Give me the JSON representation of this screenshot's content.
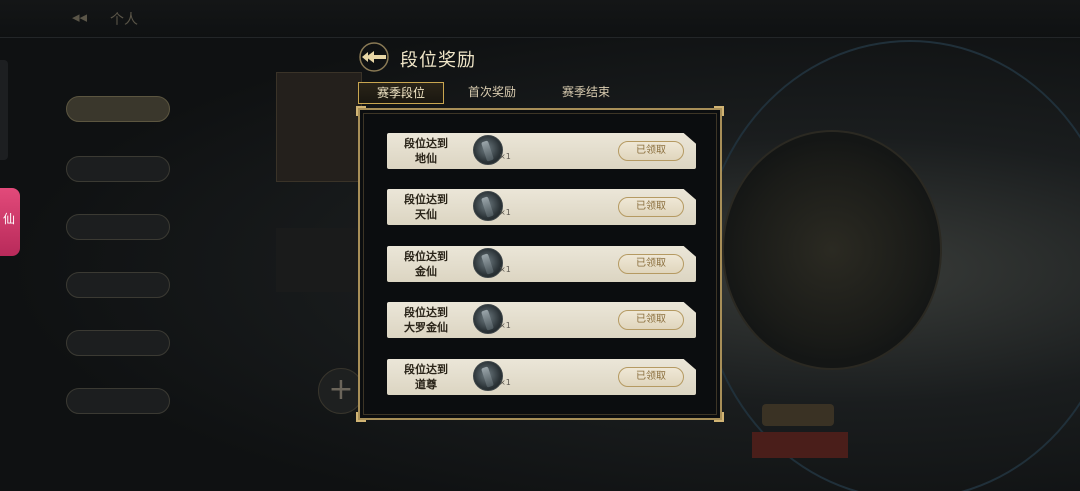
{
  "background": {
    "topbar_title": "个人",
    "menu_items": [
      "",
      "",
      "",
      "",
      "",
      ""
    ],
    "side_tab_glyph": "仙"
  },
  "dialog": {
    "title": "段位奖励",
    "tabs": [
      {
        "label": "赛季段位",
        "active": true
      },
      {
        "label": "首次奖励",
        "active": false
      },
      {
        "label": "赛季结束",
        "active": false
      }
    ],
    "rows": [
      {
        "line1": "段位达到",
        "line2": "地仙",
        "item_icon": "sword-token-icon",
        "item_count": "×1",
        "claim_label": "已领取"
      },
      {
        "line1": "段位达到",
        "line2": "天仙",
        "item_icon": "sword-token-icon",
        "item_count": "×1",
        "claim_label": "已领取"
      },
      {
        "line1": "段位达到",
        "line2": "金仙",
        "item_icon": "sword-token-icon",
        "item_count": "×1",
        "claim_label": "已领取"
      },
      {
        "line1": "段位达到",
        "line2": "大罗金仙",
        "item_icon": "sword-token-icon",
        "item_count": "×1",
        "claim_label": "已领取"
      },
      {
        "line1": "段位达到",
        "line2": "道尊",
        "item_icon": "sword-token-icon",
        "item_count": "×1",
        "claim_label": "已领取"
      }
    ]
  },
  "colors": {
    "accent_gold": "#c9a650",
    "row_bg": "#e6e0cf",
    "claimed_text": "#8a6e3c"
  }
}
